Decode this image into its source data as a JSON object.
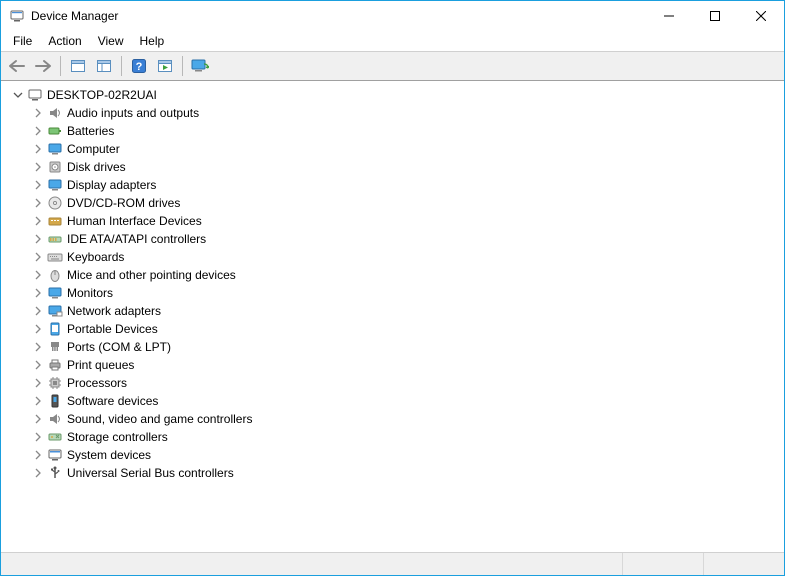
{
  "window": {
    "title": "Device Manager"
  },
  "menu": {
    "items": [
      {
        "label": "File"
      },
      {
        "label": "Action"
      },
      {
        "label": "View"
      },
      {
        "label": "Help"
      }
    ]
  },
  "toolbar": {
    "buttons": [
      {
        "name": "back",
        "icon": "arrow-left"
      },
      {
        "name": "forward",
        "icon": "arrow-right"
      },
      {
        "sep": true
      },
      {
        "name": "show-hidden",
        "icon": "panel"
      },
      {
        "name": "properties-sheet",
        "icon": "panel-split"
      },
      {
        "sep": true
      },
      {
        "name": "help",
        "icon": "help"
      },
      {
        "name": "action",
        "icon": "panel-play"
      },
      {
        "sep": true
      },
      {
        "name": "scan",
        "icon": "monitor-scan"
      }
    ]
  },
  "tree": {
    "root": {
      "label": "DESKTOP-02R2UAI",
      "icon": "computer-icon",
      "expanded": true,
      "children": [
        {
          "label": "Audio inputs and outputs",
          "icon": "audio-icon"
        },
        {
          "label": "Batteries",
          "icon": "battery-icon"
        },
        {
          "label": "Computer",
          "icon": "monitor-icon"
        },
        {
          "label": "Disk drives",
          "icon": "disk-icon"
        },
        {
          "label": "Display adapters",
          "icon": "monitor-icon"
        },
        {
          "label": "DVD/CD-ROM drives",
          "icon": "disc-icon"
        },
        {
          "label": "Human Interface Devices",
          "icon": "hid-icon"
        },
        {
          "label": "IDE ATA/ATAPI controllers",
          "icon": "controller-icon"
        },
        {
          "label": "Keyboards",
          "icon": "keyboard-icon"
        },
        {
          "label": "Mice and other pointing devices",
          "icon": "mouse-icon"
        },
        {
          "label": "Monitors",
          "icon": "monitor-icon"
        },
        {
          "label": "Network adapters",
          "icon": "network-icon"
        },
        {
          "label": "Portable Devices",
          "icon": "portable-icon"
        },
        {
          "label": "Ports (COM & LPT)",
          "icon": "port-icon"
        },
        {
          "label": "Print queues",
          "icon": "printer-icon"
        },
        {
          "label": "Processors",
          "icon": "cpu-icon"
        },
        {
          "label": "Software devices",
          "icon": "software-icon"
        },
        {
          "label": "Sound, video and game controllers",
          "icon": "audio-icon"
        },
        {
          "label": "Storage controllers",
          "icon": "storage-icon"
        },
        {
          "label": "System devices",
          "icon": "system-icon"
        },
        {
          "label": "Universal Serial Bus controllers",
          "icon": "usb-icon"
        }
      ]
    }
  }
}
